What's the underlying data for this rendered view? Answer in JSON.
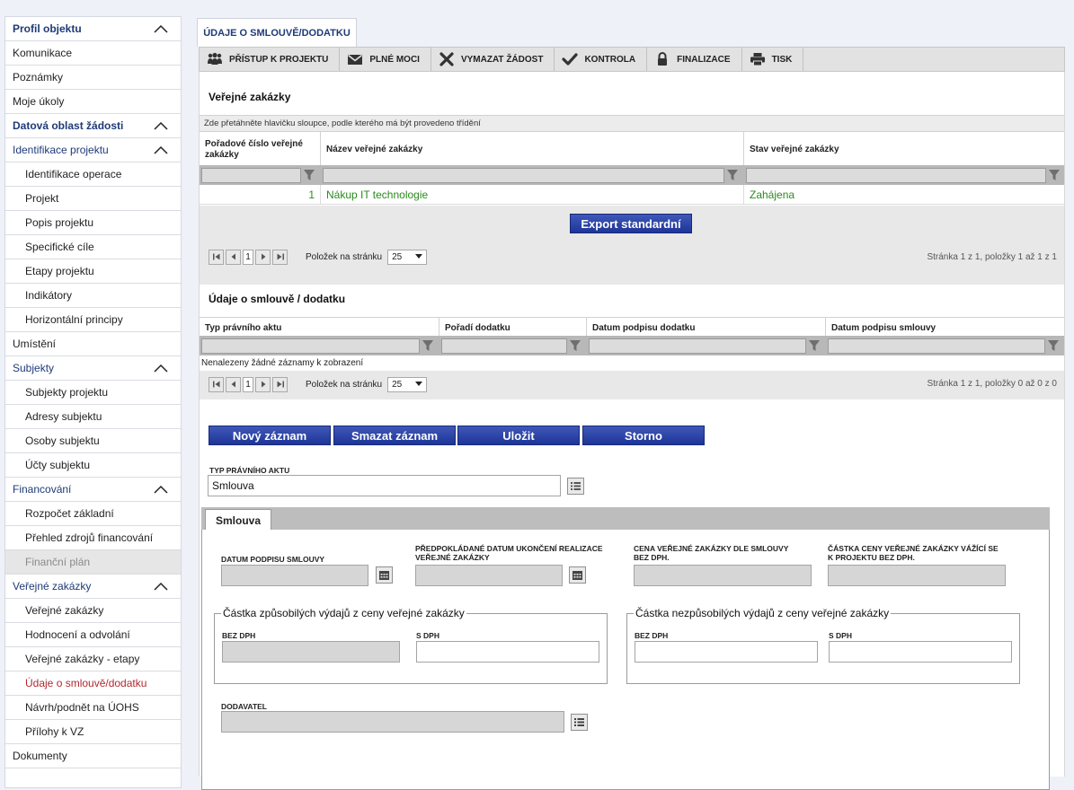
{
  "sidebar": {
    "items": [
      {
        "label": "Profil objektu",
        "kind": "head",
        "chevron": true
      },
      {
        "label": "Komunikace",
        "kind": "l1"
      },
      {
        "label": "Poznámky",
        "kind": "l1"
      },
      {
        "label": "Moje úkoly",
        "kind": "l1"
      },
      {
        "label": "Datová oblast žádosti",
        "kind": "head",
        "chevron": true
      },
      {
        "label": "Identifikace projektu",
        "kind": "sec",
        "chevron": true
      },
      {
        "label": "Identifikace operace",
        "kind": "l2"
      },
      {
        "label": "Projekt",
        "kind": "l2"
      },
      {
        "label": "Popis projektu",
        "kind": "l2"
      },
      {
        "label": "Specifické cíle",
        "kind": "l2"
      },
      {
        "label": "Etapy projektu",
        "kind": "l2"
      },
      {
        "label": "Indikátory",
        "kind": "l2"
      },
      {
        "label": "Horizontální principy",
        "kind": "l2"
      },
      {
        "label": "Umístění",
        "kind": "l1"
      },
      {
        "label": "Subjekty",
        "kind": "sec",
        "chevron": true
      },
      {
        "label": "Subjekty projektu",
        "kind": "l2"
      },
      {
        "label": "Adresy subjektu",
        "kind": "l2"
      },
      {
        "label": "Osoby subjektu",
        "kind": "l2"
      },
      {
        "label": "Účty subjektu",
        "kind": "l2"
      },
      {
        "label": "Financování",
        "kind": "sec",
        "chevron": true
      },
      {
        "label": "Rozpočet základní",
        "kind": "l2"
      },
      {
        "label": "Přehled zdrojů financování",
        "kind": "l2"
      },
      {
        "label": "Finanční plán",
        "kind": "l2",
        "state": "disabled"
      },
      {
        "label": "Veřejné zakázky",
        "kind": "sec",
        "chevron": true
      },
      {
        "label": "Veřejné zakázky",
        "kind": "l2"
      },
      {
        "label": "Hodnocení a odvolání",
        "kind": "l2"
      },
      {
        "label": "Veřejné zakázky - etapy",
        "kind": "l2"
      },
      {
        "label": "Údaje o smlouvě/dodatku",
        "kind": "l2",
        "state": "active"
      },
      {
        "label": "Návrh/podnět na ÚOHS",
        "kind": "l2"
      },
      {
        "label": "Přílohy k VZ",
        "kind": "l2"
      },
      {
        "label": "Dokumenty",
        "kind": "l1"
      }
    ]
  },
  "tab": {
    "label": "ÚDAJE O SMLOUVĚ/DODATKU"
  },
  "toolbar": {
    "buttons": [
      {
        "label": "PŘÍSTUP K PROJEKTU",
        "icon": "users-icon"
      },
      {
        "label": "PLNÉ MOCI",
        "icon": "envelope-icon"
      },
      {
        "label": "VYMAZAT ŽÁDOST",
        "icon": "delete-x-icon"
      },
      {
        "label": "KONTROLA",
        "icon": "checkmark-icon"
      },
      {
        "label": "FINALIZACE",
        "icon": "lock-icon"
      },
      {
        "label": "TISK",
        "icon": "printer-icon"
      }
    ]
  },
  "grid1": {
    "title": "Veřejné zakázky",
    "hint": "Zde přetáhněte hlavičku sloupce, podle kterého má být provedeno třídění",
    "columns": [
      "Pořadové číslo veřejné zakázky",
      "Název veřejné zakázky",
      "Stav veřejné zakázky"
    ],
    "rows": [
      [
        "1",
        "Nákup IT technologie",
        "Zahájena"
      ]
    ],
    "export_label": "Export standardní",
    "pager": {
      "page": "1",
      "per_page_label": "Položek na stránku",
      "per_page": "25",
      "info": "Stránka 1 z 1, položky 1 až 1 z 1"
    }
  },
  "grid2": {
    "title": "Údaje o smlouvě / dodatku",
    "columns": [
      "Typ právního aktu",
      "Pořadí dodatku",
      "Datum podpisu dodatku",
      "Datum podpisu smlouvy"
    ],
    "empty": "Nenalezeny žádné záznamy k zobrazení",
    "pager": {
      "page": "1",
      "per_page_label": "Položek na stránku",
      "per_page": "25",
      "info": "Stránka 1 z 1, položky 0 až 0 z 0"
    }
  },
  "actions": {
    "new": "Nový záznam",
    "delete": "Smazat záznam",
    "save": "Uložit",
    "cancel": "Storno"
  },
  "form": {
    "type_label": "TYP PRÁVNÍHO AKTU",
    "type_value": "Smlouva",
    "subtab": "Smlouva",
    "signature_date_label": "DATUM PODPISU SMLOUVY",
    "end_date_label": "PŘEDPOKLÁDANÉ DATUM UKONČENÍ REALIZACE VEŘEJNÉ ZAKÁZKY",
    "price_label": "CENA VEŘEJNÉ ZAKÁZKY DLE SMLOUVY BEZ DPH.",
    "project_price_label": "ČÁSTKA CENY VEŘEJNÉ ZAKÁZKY VÁŽÍCÍ SE K PROJEKTU BEZ DPH.",
    "eligible_legend": "Částka způsobilých výdajů z ceny veřejné zakázky",
    "ineligible_legend": "Částka nezpůsobilých výdajů z ceny veřejné zakázky",
    "bez_dph": "BEZ DPH",
    "s_dph": "S DPH",
    "supplier_label": "DODAVATEL"
  }
}
